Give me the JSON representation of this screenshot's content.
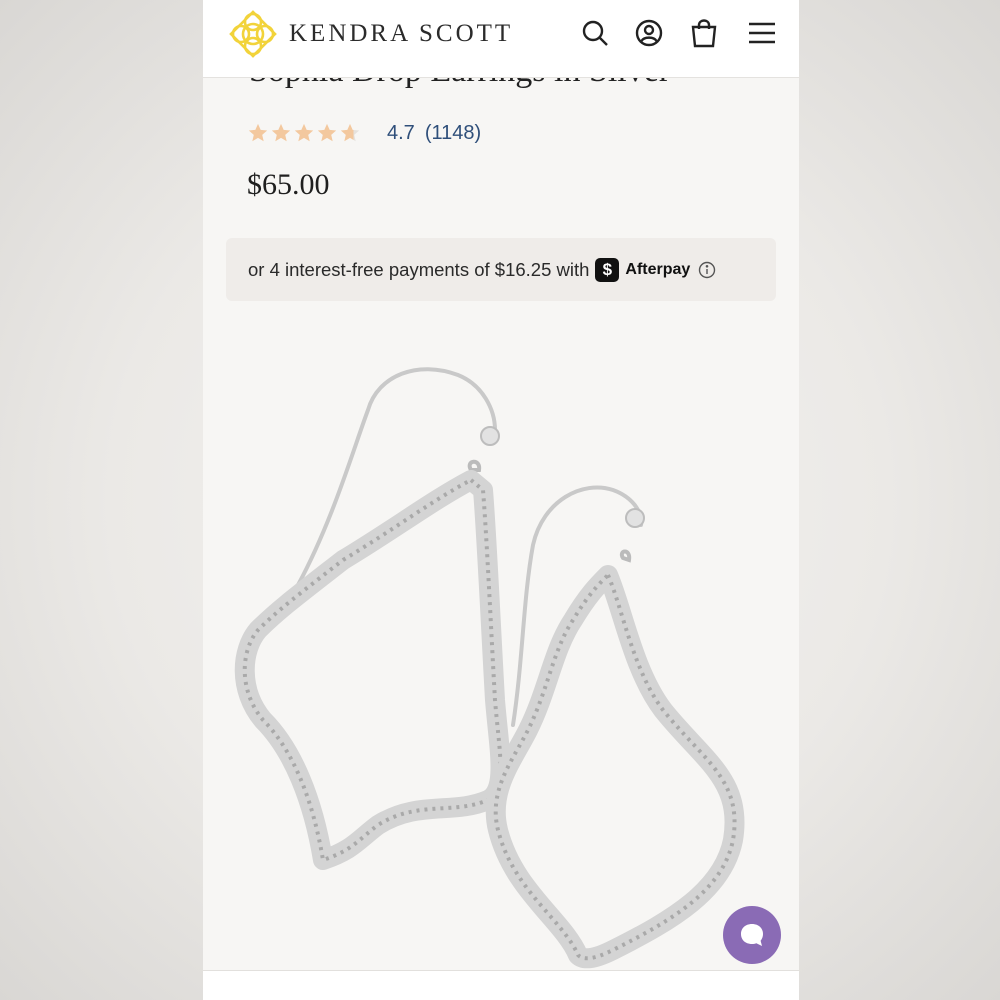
{
  "header": {
    "brand": "KENDRA SCOTT",
    "icons": [
      "search-icon",
      "account-icon",
      "bag-icon",
      "menu-icon"
    ]
  },
  "product": {
    "title": "Sophia Drop Earrings in Silver",
    "rating": {
      "value": "4.7",
      "count": "(1148)",
      "stars_filled": 4.7,
      "stars_total": 5
    },
    "price": "$65.00"
  },
  "afterpay": {
    "text": "or 4 interest-free payments of $16.25 with",
    "badge": "$",
    "brand": "Afterpay"
  },
  "colors": {
    "brand_gold": "#f2d33a",
    "star": "#f3c89e",
    "rating_text": "#2f4f7a",
    "chat": "#8a6bb5"
  }
}
